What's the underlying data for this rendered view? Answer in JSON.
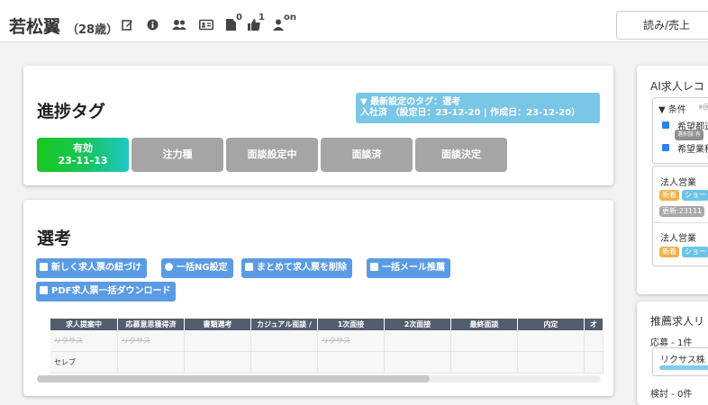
{
  "header": {
    "name": "若松翼",
    "age": "（28歳）",
    "icons": [
      "edit-icon",
      "info-icon",
      "users-icon",
      "id-card-icon",
      "document-icon",
      "thumbs-up-icon",
      "user-status-icon"
    ],
    "doc_count": "0",
    "like_count": "1",
    "status": "on",
    "read_button": "読み/売上"
  },
  "progress": {
    "title": "進捗タグ",
    "info_line1": "▼ 最新設定のタグ：選考",
    "info_line2": "入社済 （設定日：23-12-20 | 作成日：23-12-20）",
    "tags": [
      {
        "label": "有効",
        "date": "23-11-13"
      },
      {
        "label": "注力種"
      },
      {
        "label": "面談設定中"
      },
      {
        "label": "面談済"
      },
      {
        "label": "面談決定"
      }
    ]
  },
  "selection": {
    "title": "選考",
    "buttons": [
      "新しく求人票の紐づけ",
      "一括NG設定",
      "まとめて求人票を削除",
      "一括メール推薦",
      "PDF求人票一括ダウンロード"
    ],
    "columns": [
      "求人提案中",
      "応募意思獲得済",
      "書類選考",
      "カジュアル面談 / ",
      "1次面接",
      "2次面接",
      "最終面談",
      "内定",
      "オ"
    ],
    "rows": [
      [
        "リクサス",
        "リクサス",
        "",
        "",
        "リクサス",
        "",
        "",
        "",
        ""
      ],
      [
        "セレブ",
        "",
        "",
        "",
        "",
        "",
        "",
        "",
        ""
      ]
    ]
  },
  "ai_panel": {
    "title": "AI求人レコ",
    "condition_label": "▼ 条件",
    "condition_note": "※回",
    "cond1": "希望都道",
    "cond1_chip": "選択肢:有",
    "cond2": "希望業種",
    "job1_title": "法人営業",
    "job1_chip_new": "新着",
    "job1_chip_show": "ショー",
    "job1_updated": "更新:23111",
    "job2_title": "法人営業",
    "job2_chip_new": "新着",
    "job2_chip_show": "ショー"
  },
  "recommend_panel": {
    "title": "推薦求人リ",
    "applied_label": "応募 - 1件",
    "applied_item": "リクサス株",
    "review_label": "検討 - 0件"
  }
}
